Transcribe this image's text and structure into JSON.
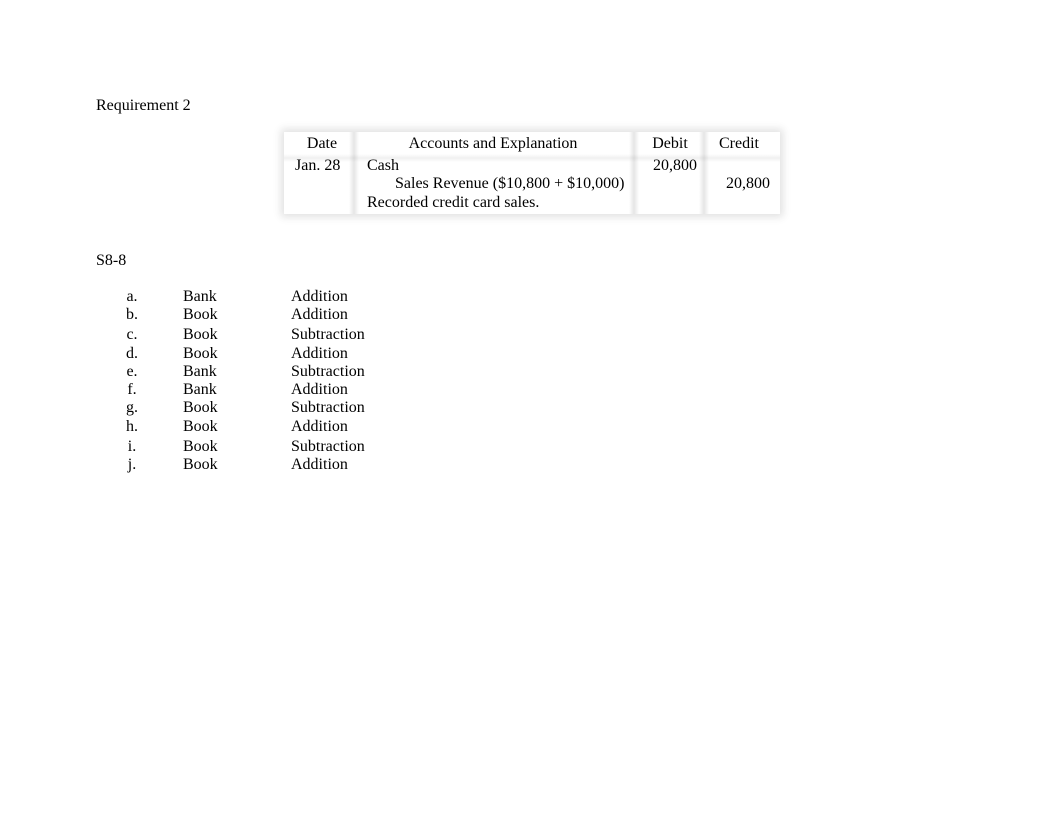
{
  "requirement_title": "Requirement 2",
  "journal": {
    "headers": {
      "date": "Date",
      "accounts": "Accounts and Explanation",
      "debit": "Debit",
      "credit": "Credit"
    },
    "entry": {
      "date": "Jan. 28",
      "debit_account": "Cash",
      "debit_amount": "20,800",
      "credit_account": "Sales Revenue ($10,800 + $10,000)",
      "credit_amount": "20,800",
      "explanation": "Recorded credit card sales."
    }
  },
  "exercise_title": "S8-8",
  "items": [
    {
      "letter": "a.",
      "side": "Bank",
      "action": "Addition"
    },
    {
      "letter": "b.",
      "side": "Book",
      "action": "Addition"
    },
    {
      "letter": "c.",
      "side": "Book",
      "action": "Subtraction"
    },
    {
      "letter": "d.",
      "side": "Book",
      "action": "Addition"
    },
    {
      "letter": "e.",
      "side": "Bank",
      "action": "Subtraction"
    },
    {
      "letter": "f.",
      "side": "Bank",
      "action": "Addition"
    },
    {
      "letter": "g.",
      "side": "Book",
      "action": "Subtraction"
    },
    {
      "letter": "h.",
      "side": "Book",
      "action": "Addition"
    },
    {
      "letter": "i.",
      "side": "Book",
      "action": "Subtraction"
    },
    {
      "letter": "j.",
      "side": "Book",
      "action": "Addition"
    }
  ]
}
